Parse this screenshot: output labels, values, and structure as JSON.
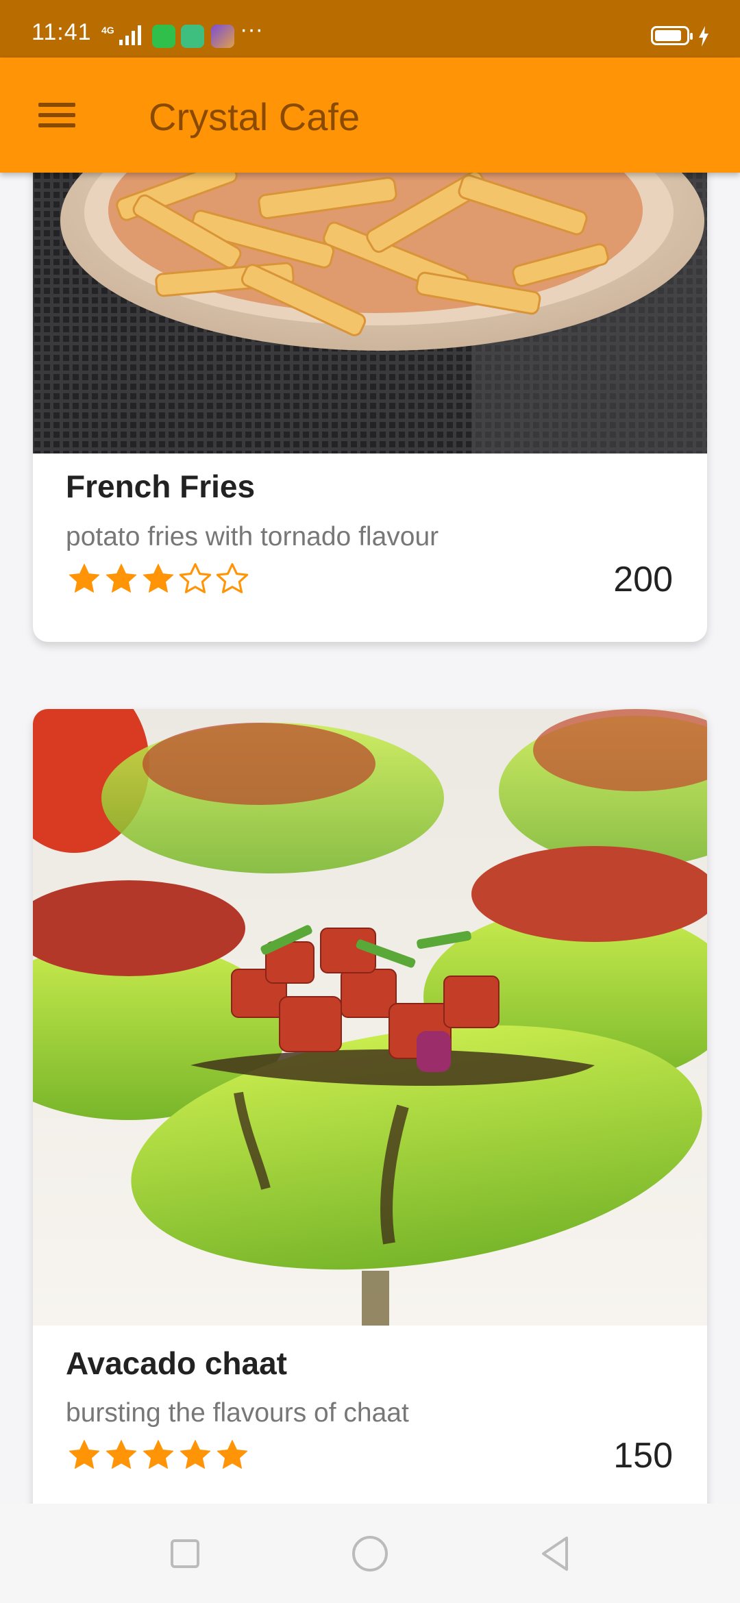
{
  "status_bar": {
    "time": "11:41",
    "network": "4G",
    "more": "···"
  },
  "app_bar": {
    "title": "Crystal Cafe"
  },
  "menu_items": [
    {
      "name": "French Fries",
      "description": "potato fries with tornado flavour",
      "rating": 3,
      "max_rating": 5,
      "price": "200"
    },
    {
      "name": "Avacado chaat",
      "description": "bursting the flavours of chaat",
      "rating": 5,
      "max_rating": 5,
      "price": "150"
    }
  ],
  "colors": {
    "status_bar": "#b96c00",
    "app_bar": "#ff9407",
    "title_text": "#8a4a00",
    "star": "#ff9407"
  },
  "navigation": {
    "icons": [
      "recents-icon",
      "home-icon",
      "back-icon"
    ]
  }
}
